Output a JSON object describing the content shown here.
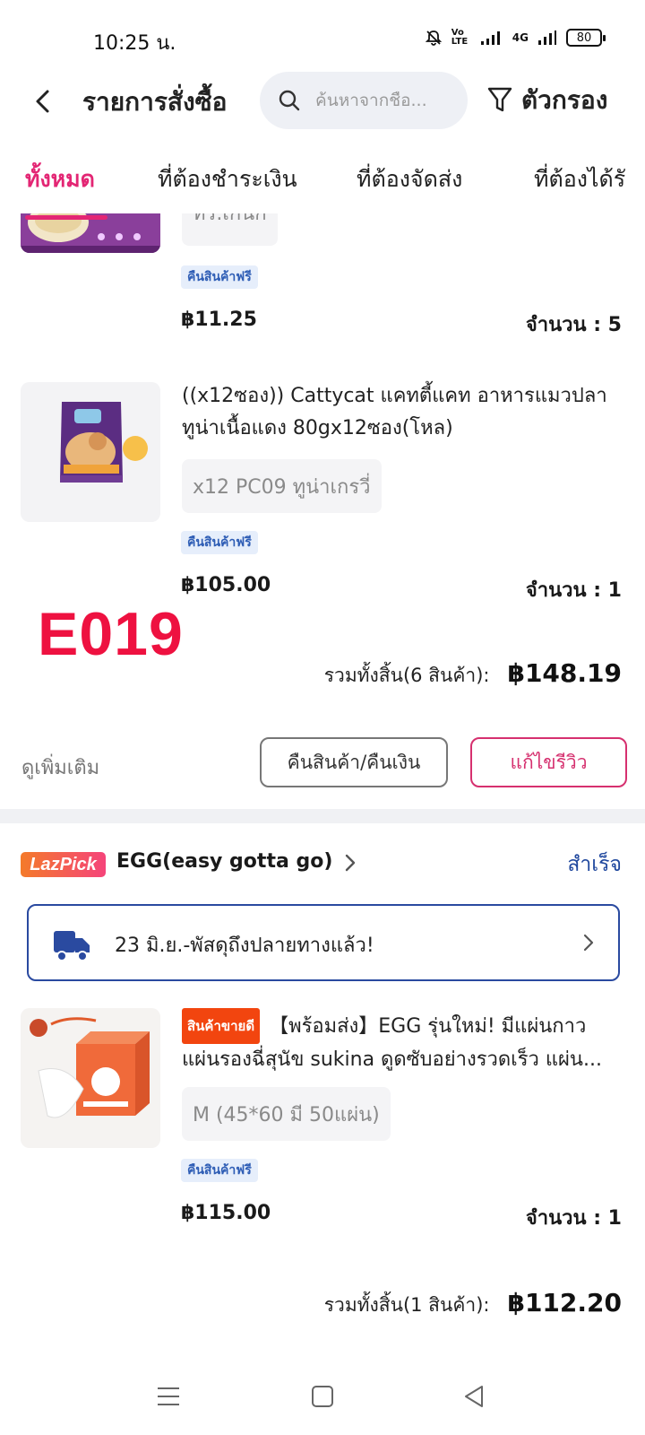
{
  "status_bar": {
    "time": "10:25 น.",
    "network": "4G",
    "volte": "Vo LTE",
    "battery": "80"
  },
  "header": {
    "title": "รายการสั่งซื้อ",
    "search_placeholder": "ค้นหาจากชื่อ...",
    "filter_label": "ตัวกรอง"
  },
  "tabs": [
    {
      "label": "ทั้งหมด",
      "active": true
    },
    {
      "label": "ที่ต้องชำระเงิน",
      "active": false
    },
    {
      "label": "ที่ต้องจัดส่ง",
      "active": false
    },
    {
      "label": "ที่ต้องได้รั",
      "active": false
    }
  ],
  "order1": {
    "items": [
      {
        "variant": "ทร.เกนก",
        "free_return": "คืนสินค้าฟรี",
        "price": "฿11.25",
        "quantity": "จำนวน : 5"
      },
      {
        "title": "((x12ซอง)) Cattycat  แคทตี้แคท อาหารแมวปลาทูน่าเนื้อแดง 80gx12ซอง(โหล)",
        "variant": "x12 PC09 ทูน่าเกรวี่",
        "free_return": "คืนสินค้าฟรี",
        "price": "฿105.00",
        "quantity": "จำนวน : 1"
      }
    ],
    "total_label": "รวมทั้งสิ้น(6 สินค้า):",
    "total_value": "฿148.19",
    "see_more": "ดูเพิ่มเติม",
    "return_button": "คืนสินค้า/คืนเงิน",
    "review_button": "แก้ไขรีวิว"
  },
  "watermark": "E019",
  "order2": {
    "badge": "LazPick",
    "shop_name": "EGG(easy gotta go)",
    "status": "สำเร็จ",
    "delivery_text": "23 มิ.ย.-พัสดุถึงปลายทางแล้ว!",
    "item": {
      "bestseller": "สินค้าขายดี",
      "title": "【พร้อมส่ง】EGG รุ่นใหม่! มีแผ่นกาว แผ่นรองฉี่สุนัข sukina ดูดซับอย่างรวดเร็ว แผ่น...",
      "variant": "M (45*60 มี 50แผ่น)",
      "free_return": "คืนสินค้าฟรี",
      "price": "฿115.00",
      "quantity": "จำนวน : 1"
    },
    "total_label": "รวมทั้งสิ้น(1 สินค้า):",
    "total_value": "฿112.20"
  },
  "icons": {
    "back": "back-arrow-icon",
    "search": "search-icon",
    "filter": "filter-icon",
    "truck": "truck-icon",
    "chevron": "chevron-right-icon",
    "nav_menu": "menu-icon",
    "nav_home": "home-icon",
    "nav_back": "back-triangle-icon"
  },
  "colors": {
    "accent": "#e32674",
    "review_border": "#d6306f",
    "status_blue": "#20489e",
    "free_return_bg": "#e6eefb",
    "free_return_text": "#2e5db5",
    "bestseller_bg": "#f2450f",
    "watermark": "#ee1140"
  }
}
